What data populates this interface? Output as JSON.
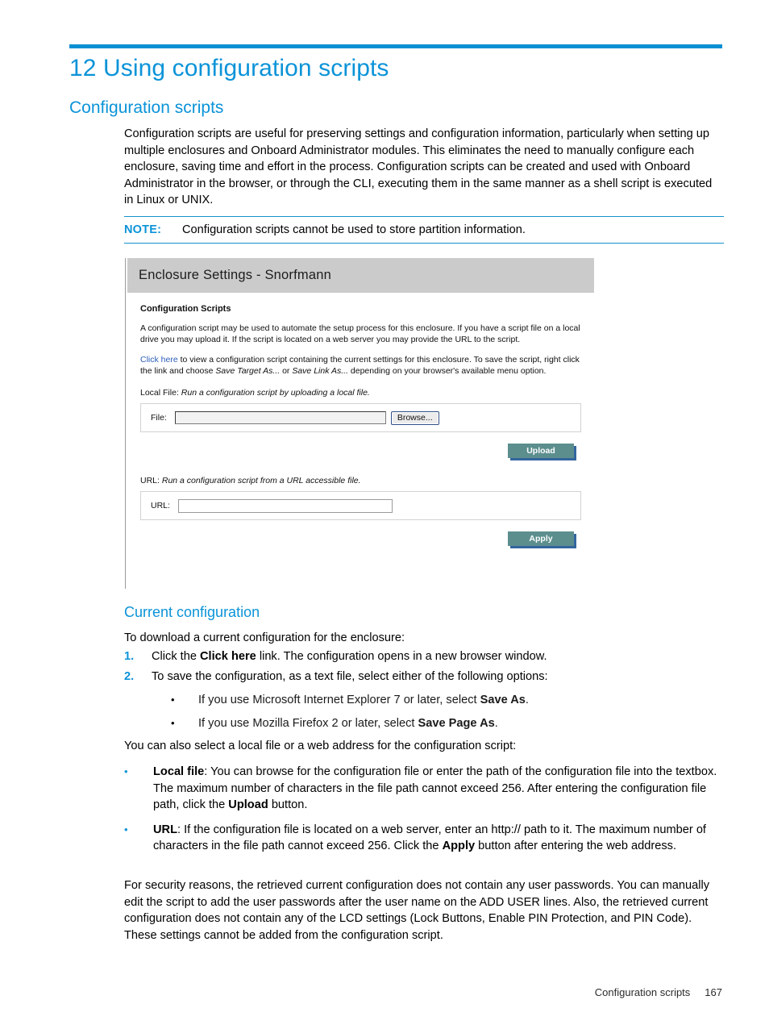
{
  "document": {
    "chapter_title": "12 Using configuration scripts",
    "section_heading": "Configuration scripts",
    "intro_paragraph": "Configuration scripts are useful for preserving settings and configuration information, particularly when setting up multiple enclosures and Onboard Administrator modules. This eliminates the need to manually configure each enclosure, saving time and effort in the process. Configuration scripts can be created and used with Onboard Administrator in the browser, or through the CLI, executing them in the same manner as a shell script is executed in Linux or UNIX.",
    "note": {
      "label": "NOTE:",
      "text": "Configuration scripts cannot be used to store partition information."
    },
    "subsection_heading": "Current configuration",
    "download_lead": "To download a current configuration for the enclosure:",
    "numbered_steps": [
      {
        "number": "1.",
        "prefix": "Click the ",
        "bold": "Click here",
        "suffix": " link. The configuration opens in a new browser window."
      },
      {
        "number": "2.",
        "prefix": "To save the configuration, as a text file, select either of the following options:",
        "bold": "",
        "suffix": ""
      }
    ],
    "sub_bullets": [
      {
        "marker": "•",
        "prefix": "If you use Microsoft Internet Explorer 7 or later, select ",
        "bold": "Save As",
        "suffix": "."
      },
      {
        "marker": "•",
        "prefix": "If you use Mozilla Firefox 2 or later, select ",
        "bold": "Save Page As",
        "suffix": "."
      }
    ],
    "after_bullets_paragraph": "You can also select a local file or a web address for the configuration script:",
    "blue_bullets": [
      {
        "marker": "•",
        "bold_lead": "Local file",
        "text_part1": ": You can browse for the configuration file or enter the path of the configuration file into the textbox. The maximum number of characters in the file path cannot exceed 256. After entering the configuration file path, click the ",
        "bold_mid": "Upload",
        "text_part2": " button."
      },
      {
        "marker": "•",
        "bold_lead": "URL",
        "text_part1": ": If the configuration file is located on a web server, enter an http:// path to it. The maximum number of characters in the file path cannot exceed 256. Click the ",
        "bold_mid": "Apply",
        "text_part2": " button after entering the web address."
      }
    ],
    "closing_paragraph": "For security reasons, the retrieved current configuration does not contain any user passwords. You can manually edit the script to add the user passwords after the user name on the ADD USER lines. Also, the retrieved current configuration does not contain any of the LCD settings (Lock Buttons, Enable PIN Protection, and PIN Code). These settings cannot be added from the configuration script."
  },
  "footer": {
    "section_name": "Configuration scripts",
    "page_number": "167"
  },
  "figure": {
    "header_title": "Enclosure Settings - Snorfmann",
    "section_title": "Configuration Scripts",
    "paragraph_1": "A configuration script may be used to automate the setup process for this enclosure. If you have a script file on a local drive you may upload it. If the script is located on a web server you may provide the URL to the script.",
    "paragraph_2": {
      "link_text": "Click here",
      "text_1": " to view a configuration script containing the current settings for this enclosure. To save the script, right click the link and choose ",
      "italic_1": "Save Target As...",
      "text_2": " or ",
      "italic_2": "Save Link As...",
      "text_3": " depending on your browser's available menu option."
    },
    "local_file": {
      "label": "Local File:",
      "description": "Run a configuration script by uploading a local file.",
      "field_label": "File:",
      "field_value": "",
      "field_placeholder": "",
      "browse_button": "Browse...",
      "submit_button": "Upload"
    },
    "url_section": {
      "label": "URL:",
      "description": "Run a configuration script from a URL accessible file.",
      "field_label": "URL:",
      "field_value": "",
      "field_placeholder": "",
      "submit_button": "Apply"
    }
  },
  "colors": {
    "hp_blue": "#0b93d8",
    "rule_blue": "#0b8fd4",
    "panel_header_grey": "#cbcbcb",
    "teal_button": "#5c8e8e",
    "button_shadow_blue": "#33659e",
    "link_blue": "#2b5fbb"
  }
}
